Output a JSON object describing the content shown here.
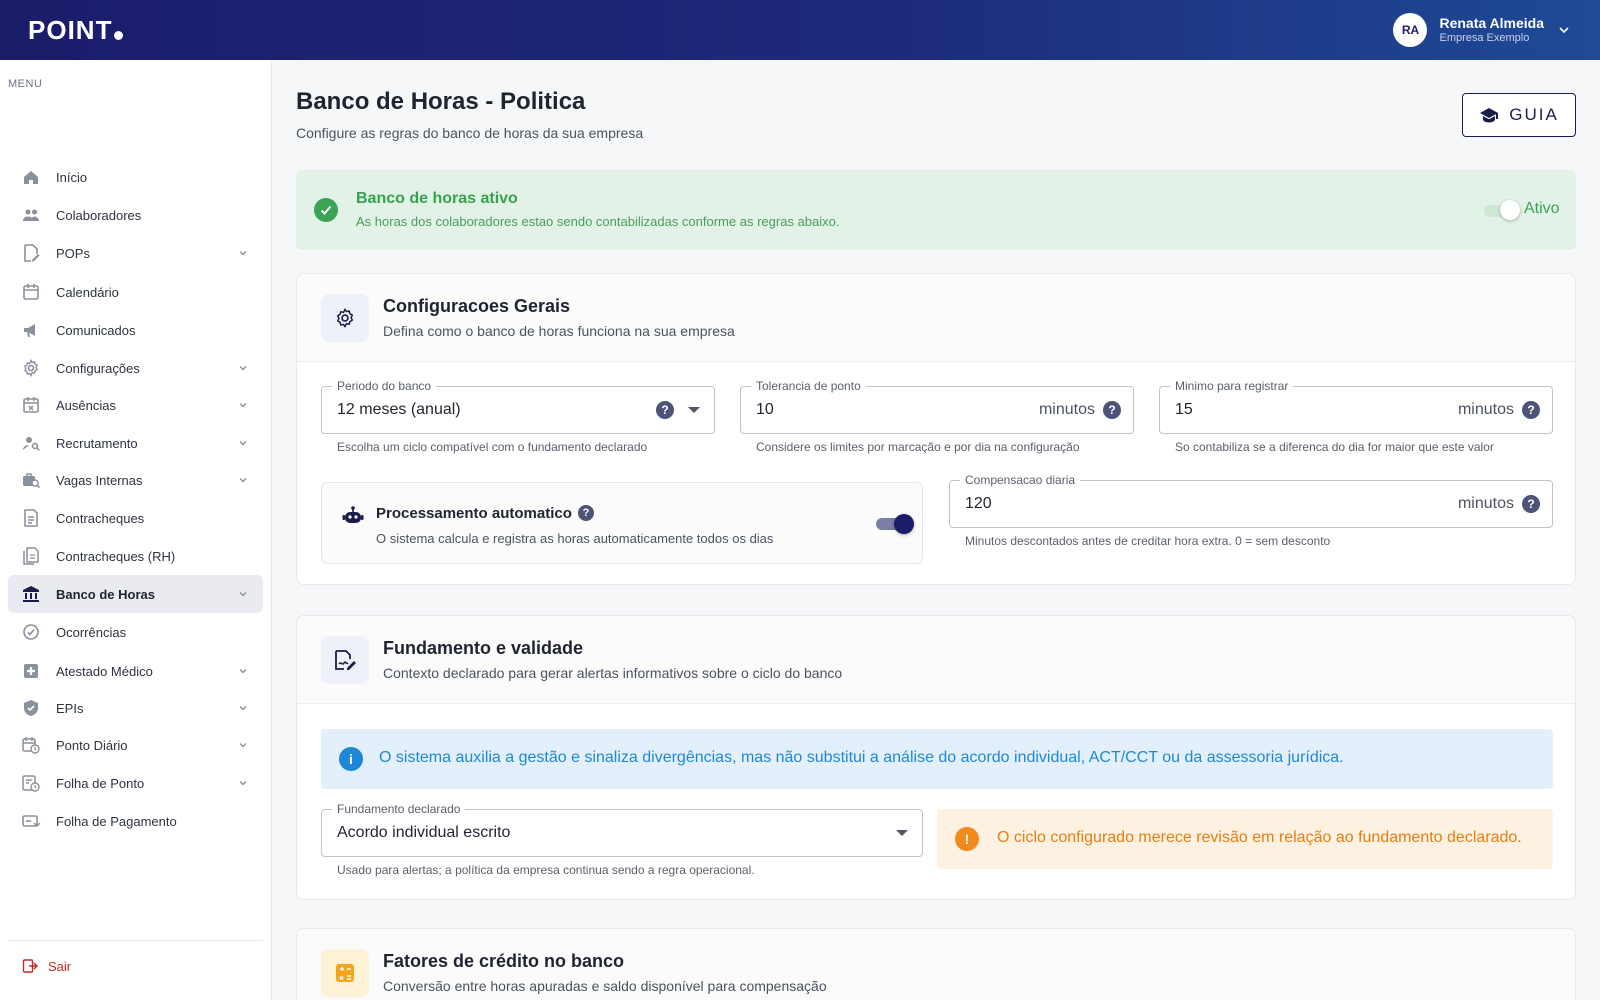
{
  "header": {
    "logo": "POINT",
    "user_initials": "RA",
    "user_name": "Renata Almeida",
    "user_company": "Empresa Exemplo"
  },
  "sidebar": {
    "menu_label": "MENU",
    "items": [
      {
        "label": "Início",
        "icon": "home-icon",
        "chevron": false
      },
      {
        "label": "Colaboradores",
        "icon": "people-icon",
        "chevron": false
      },
      {
        "label": "POPs",
        "icon": "document-edit-icon",
        "chevron": true
      },
      {
        "label": "Calendário",
        "icon": "calendar-icon",
        "chevron": false
      },
      {
        "label": "Comunicados",
        "icon": "megaphone-icon",
        "chevron": false
      },
      {
        "label": "Configurações",
        "icon": "gear-icon",
        "chevron": true
      },
      {
        "label": "Ausências",
        "icon": "calendar-x-icon",
        "chevron": true
      },
      {
        "label": "Recrutamento",
        "icon": "person-search-icon",
        "chevron": true
      },
      {
        "label": "Vagas Internas",
        "icon": "job-search-icon",
        "chevron": true
      },
      {
        "label": "Contracheques",
        "icon": "receipt-icon",
        "chevron": false
      },
      {
        "label": "Contracheques (RH)",
        "icon": "receipt-multiple-icon",
        "chevron": false
      },
      {
        "label": "Banco de Horas",
        "icon": "bank-icon",
        "chevron": true,
        "active": true
      },
      {
        "label": "Ocorrências",
        "icon": "check-circle-icon",
        "chevron": false
      },
      {
        "label": "Atestado Médico",
        "icon": "medical-icon",
        "chevron": true
      },
      {
        "label": "EPIs",
        "icon": "shield-icon",
        "chevron": true
      },
      {
        "label": "Ponto Diário",
        "icon": "calendar-clock-icon",
        "chevron": true
      },
      {
        "label": "Folha de Ponto",
        "icon": "timesheet-icon",
        "chevron": true
      },
      {
        "label": "Folha de Pagamento",
        "icon": "payment-icon",
        "chevron": false
      }
    ],
    "logout_label": "Sair"
  },
  "page": {
    "title": "Banco de Horas - Politica",
    "subtitle": "Configure as regras do banco de horas da sua empresa",
    "guide_label": "GUIA"
  },
  "status": {
    "title": "Banco de horas ativo",
    "description": "As horas dos colaboradores estao sendo contabilizadas conforme as regras abaixo.",
    "toggle_label": "Ativo",
    "enabled": true
  },
  "general": {
    "title": "Configuracoes Gerais",
    "subtitle": "Defina como o banco de horas funciona na sua empresa",
    "period": {
      "label": "Periodo do banco",
      "value": "12 meses (anual)",
      "hint": "Escolha um ciclo compatível com o fundamento declarado"
    },
    "tolerance": {
      "label": "Tolerancia de ponto",
      "value": "10",
      "unit": "minutos",
      "hint": "Considere os limites por marcação e por dia na configuração"
    },
    "minimum": {
      "label": "Minimo para registrar",
      "value": "15",
      "unit": "minutos",
      "hint": "So contabiliza se a diferenca do dia for maior que este valor"
    },
    "auto": {
      "title": "Processamento automatico",
      "description": "O sistema calcula e registra as horas automaticamente todos os dias",
      "enabled": true
    },
    "compensation": {
      "label": "Compensacao diaria",
      "value": "120",
      "unit": "minutos",
      "hint": "Minutos descontados antes de creditar hora extra. 0 = sem desconto"
    }
  },
  "basis": {
    "title": "Fundamento e validade",
    "subtitle": "Contexto declarado para gerar alertas informativos sobre o ciclo do banco",
    "info": "O sistema auxilia a gestão e sinaliza divergências, mas não substitui a análise do acordo individual, ACT/CCT ou da assessoria jurídica.",
    "declared": {
      "label": "Fundamento declarado",
      "value": "Acordo individual escrito",
      "hint": "Usado para alertas; a política da empresa continua sendo a regra operacional."
    },
    "warning": "O ciclo configurado merece revisão em relação ao fundamento declarado."
  },
  "credit": {
    "title": "Fatores de crédito no banco",
    "subtitle": "Conversão entre horas apuradas e saldo disponível para compensação"
  },
  "colors": {
    "brand": "#1b1c6a",
    "success": "#38a150",
    "info": "#1e88d6",
    "warning": "#e57f12"
  }
}
